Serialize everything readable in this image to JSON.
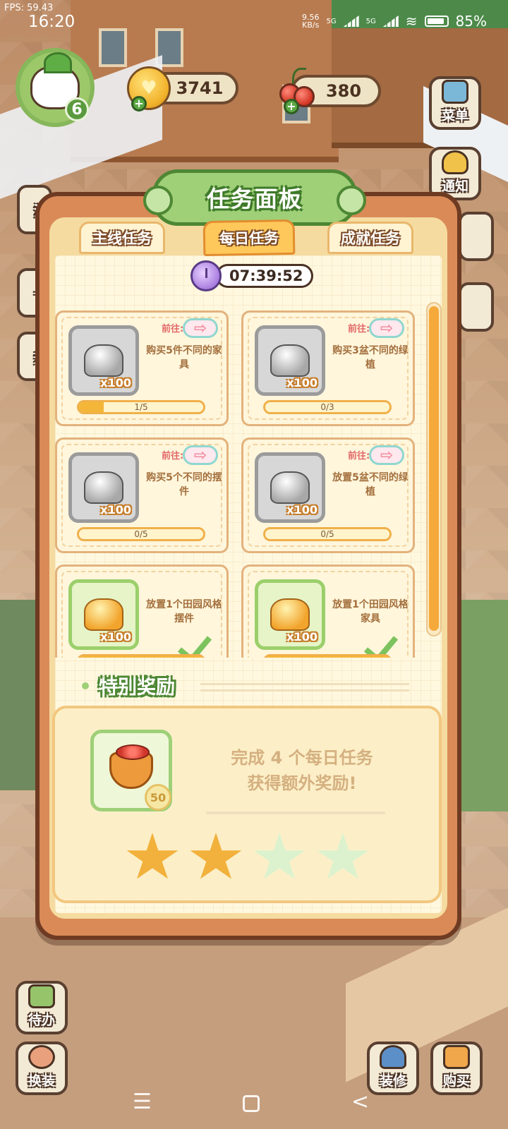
{
  "status_bar": {
    "fps": "FPS: 59.43",
    "time": "16:20",
    "net_speed_value": "9.56",
    "net_speed_unit": "KB/s",
    "sim1": "5G",
    "sim2": "5G",
    "battery": "85%"
  },
  "hud": {
    "player_level": "6",
    "coins": "3741",
    "cherries": "380",
    "plus_symbol": "+"
  },
  "side_buttons": {
    "menu": "菜单",
    "notice": "通知",
    "todo": "待办",
    "dress": "换装",
    "decorate": "装修",
    "buy": "购买",
    "partial_left_1": "活",
    "partial_left_2": "十",
    "partial_left_3": "升"
  },
  "panel": {
    "title": "任务面板",
    "tabs": [
      {
        "label": "主线任务",
        "active": false
      },
      {
        "label": "每日任务",
        "active": true
      },
      {
        "label": "成就任务",
        "active": false
      }
    ],
    "timer": "07:39:52",
    "tasks": [
      {
        "goto": "前往:",
        "desc": "购买5件不同的家具",
        "reward_qty": "x100",
        "progress": "1/5",
        "progress_fraction": 0.2,
        "completed": false,
        "reward_color": "silver"
      },
      {
        "goto": "前往:",
        "desc": "购买3盆不同的绿植",
        "reward_qty": "x100",
        "progress": "0/3",
        "progress_fraction": 0,
        "completed": false,
        "reward_color": "silver"
      },
      {
        "goto": "前往:",
        "desc": "购买5个不同的摆件",
        "reward_qty": "x100",
        "progress": "0/5",
        "progress_fraction": 0,
        "completed": false,
        "reward_color": "silver"
      },
      {
        "goto": "前往:",
        "desc": "放置5盆不同的绿植",
        "reward_qty": "x100",
        "progress": "0/5",
        "progress_fraction": 0,
        "completed": false,
        "reward_color": "silver"
      },
      {
        "goto": "",
        "desc": "放置1个田园风格摆件",
        "reward_qty": "x100",
        "progress": "",
        "progress_fraction": 1,
        "completed": true,
        "reward_color": "gold"
      },
      {
        "goto": "",
        "desc": "放置1个田园风格家具",
        "reward_qty": "x100",
        "progress": "",
        "progress_fraction": 1,
        "completed": true,
        "reward_color": "gold"
      }
    ],
    "special": {
      "title": "特别奖励",
      "reward_qty": "50",
      "line1": "完成 4 个每日任务",
      "line2": "获得额外奖励!",
      "stars_total": 4,
      "stars_earned": 2
    },
    "icons": {
      "goto_arrow": "⇨"
    }
  },
  "nav": {
    "menu_glyph": "☰",
    "back_glyph": "<"
  }
}
